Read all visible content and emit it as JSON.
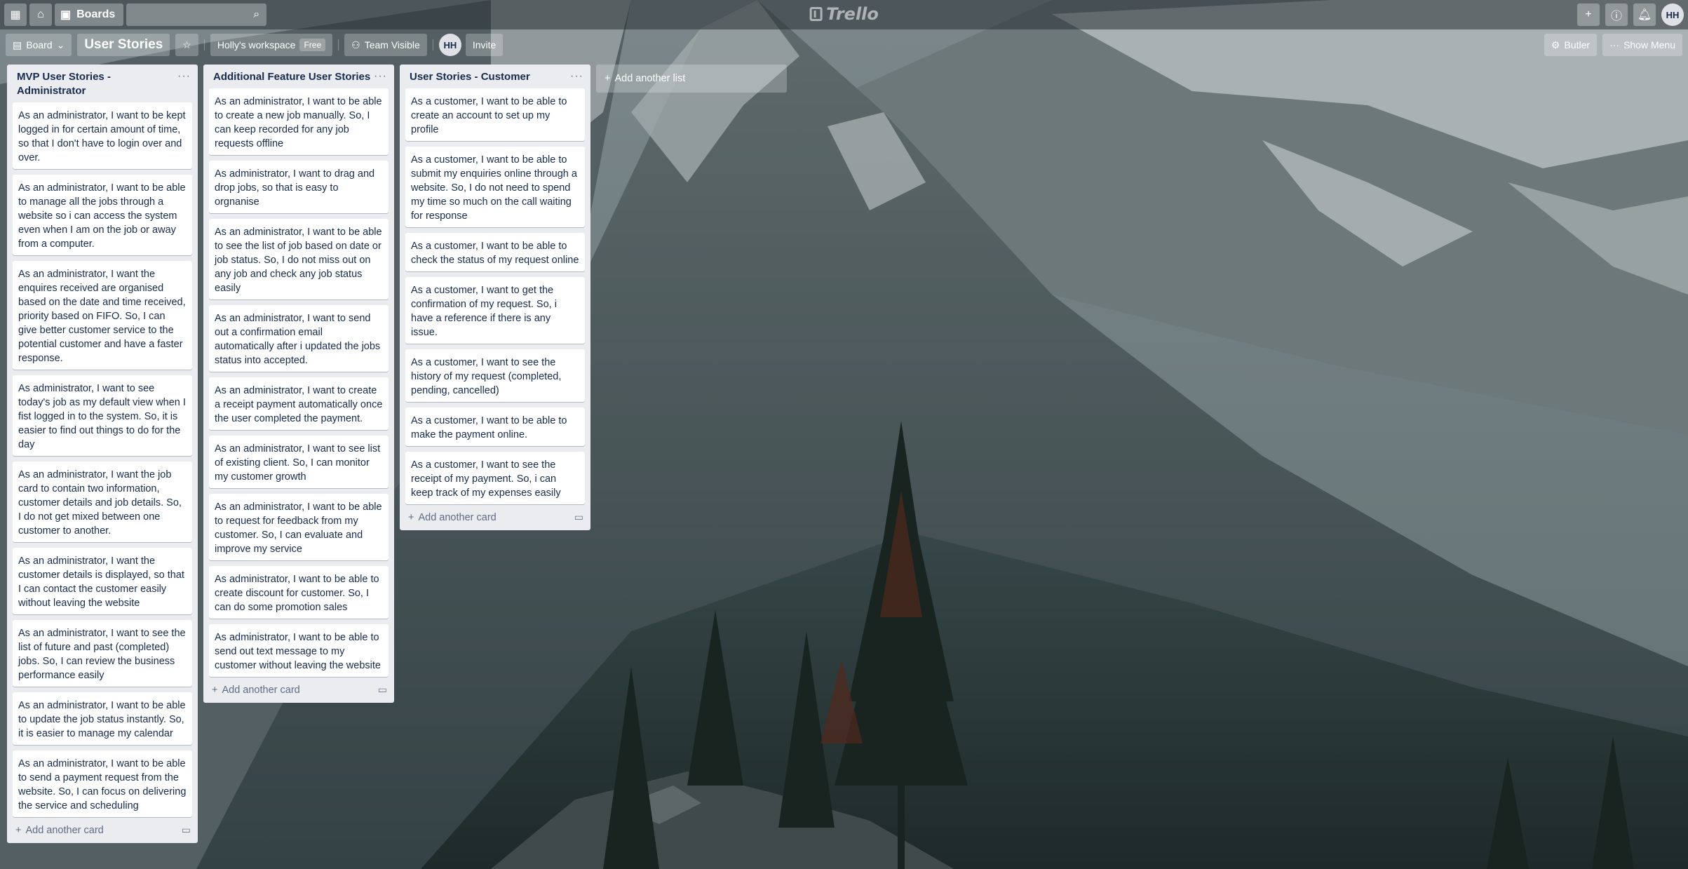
{
  "header": {
    "boards_label": "Boards",
    "logo_text": "Trello",
    "user_initials": "HH"
  },
  "board": {
    "view_label": "Board",
    "title": "User Stories",
    "workspace": "Holly's workspace",
    "workspace_badge": "Free",
    "visibility": "Team Visible",
    "member_initials": "HH",
    "invite_label": "Invite",
    "butler_label": "Butler",
    "show_menu_label": "Show Menu"
  },
  "lists": [
    {
      "title": "MVP User Stories - Administrator",
      "add_card": "Add another card",
      "cards": [
        "As an administrator, I want to be kept logged in for certain amount of time, so that I don't have to login over and over.",
        "As an administrator, I want to be able to manage all the jobs through a website so i can access the system even when I am on the job or away from a computer.",
        "As an administrator, I want the enquires received are organised based on the date and time received, priority based on FIFO. So, I can give better customer service to the potential customer and have a faster response.",
        "As administrator, I want to see today's job as my default view when I fist logged in to the system. So, it is easier to find out things to do for the day",
        "As an administrator, I want the job card to contain two information, customer details and job details. So, I do not get mixed between one customer to another.",
        "As an administrator, I want the customer details is displayed, so that I can contact the customer easily without leaving the website",
        "As an administrator, I want to see the list of future and past (completed) jobs. So, I can review the business performance easily",
        "As an administrator, I want to be able to update the job status instantly. So, it is easier to manage my calendar",
        "As an administrator, I want to be able to send a payment request from the website. So, I can focus on delivering the service and scheduling"
      ]
    },
    {
      "title": "Additional Feature User Stories",
      "add_card": "Add another card",
      "cards": [
        "As an administrator, I want to be able to create a new job manually. So, I can keep recorded for any job requests offline",
        "As administrator, I want to drag and drop jobs, so that is easy to orgnanise",
        "As an administrator, I want to be able to see the list of job based on date or job status. So, I do not miss out on any job and check any job status easily",
        "As an administrator, I want to send out a confirmation email automatically after i updated the jobs status into accepted.",
        "As an administrator, I want to create a receipt payment automatically once the user completed the payment.",
        "As an administrator, I want to see list of existing client. So, I can monitor my customer growth",
        "As an administrator, I want to be able to request for feedback from my customer. So, I can evaluate and improve my service",
        "As administrator, I want to be able to create discount for customer. So, I can do some promotion sales",
        "As administrator, I want to be able to send out text message to my customer without leaving the website"
      ]
    },
    {
      "title": "User Stories - Customer",
      "add_card": "Add another card",
      "cards": [
        "As a customer, I want to be able to create an account to set up my profile",
        "As a customer, I want to be able to submit my enquiries online through a website. So, I do not need to spend my time so much on the call waiting for response",
        "As a customer, I want to be able to check the status of my request online",
        "As a customer, I want to get the confirmation of my request. So, i have a reference if there is any issue.",
        "As a customer, I want to see the history of my request (completed, pending, cancelled)",
        "As a customer, I want to be able to make the payment online.",
        "As a customer, I want to see the receipt of my payment. So, i can keep track of my expenses easily"
      ]
    }
  ],
  "add_list_label": "Add another list"
}
